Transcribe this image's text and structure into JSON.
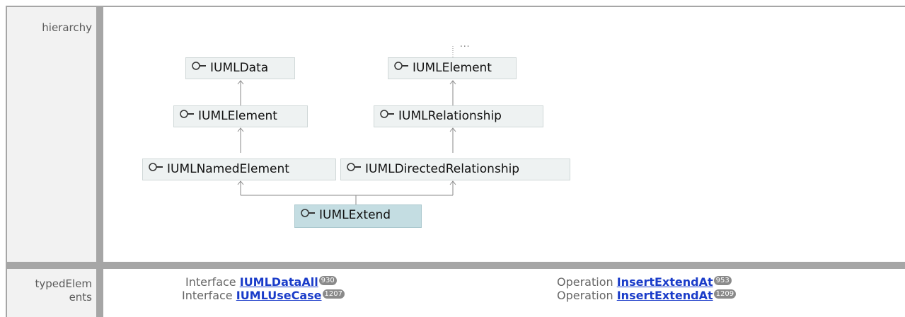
{
  "hierarchy": {
    "label": "hierarchy",
    "more_indicator": "...",
    "nodes": [
      {
        "id": "uml-data",
        "label": "IUMLData"
      },
      {
        "id": "uml-element-top",
        "label": "IUMLElement"
      },
      {
        "id": "uml-element",
        "label": "IUMLElement"
      },
      {
        "id": "uml-relationship",
        "label": "IUMLRelationship"
      },
      {
        "id": "uml-named-element",
        "label": "IUMLNamedElement"
      },
      {
        "id": "uml-directed-relationship",
        "label": "IUMLDirectedRelationship"
      },
      {
        "id": "uml-extend",
        "label": "IUMLExtend",
        "selected": true
      }
    ]
  },
  "typed_elements": {
    "label_line1": "typedElem",
    "label_line2": "ents",
    "items": [
      {
        "kind": "Interface",
        "name": "IUMLDataAll",
        "badge": "930"
      },
      {
        "kind": "Interface",
        "name": "IUMLUseCase",
        "badge": "1207"
      },
      {
        "kind": "Operation",
        "name": "InsertExtendAt",
        "badge": "953"
      },
      {
        "kind": "Operation",
        "name": "InsertExtendAt",
        "badge": "1209"
      }
    ]
  },
  "colors": {
    "grid": "#a6a6a6",
    "label_bg": "#f2f2f2",
    "node_bg": "#eef2f2",
    "selected_node_bg": "#c4dde2",
    "link": "#1a3cc9",
    "badge": "#8a8a8a"
  },
  "icons": {
    "interface": "interface-lollipop-icon",
    "arrow": "arrow-up-icon"
  }
}
